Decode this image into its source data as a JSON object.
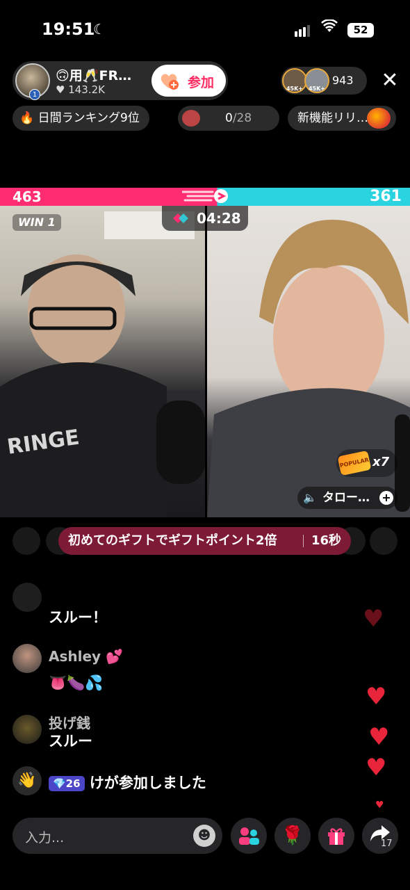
{
  "status_bar": {
    "time": "19:51",
    "battery": "52"
  },
  "host": {
    "name": "🙃用🥂FR…",
    "likes_label": "♥ 143.2K",
    "avatar_badge": "1"
  },
  "join_button": {
    "label": "参加"
  },
  "viewers": {
    "avatar_1_badge": "45K+",
    "avatar_2_badge": "45K+",
    "count": "943"
  },
  "close_label": "✕",
  "pills": {
    "ranking": "🔥 日間ランキング9位",
    "goal_current": "0",
    "goal_total": "/28",
    "new_feature": "新機能リリ…"
  },
  "battle": {
    "left_score": "463",
    "right_score": "361",
    "timer": "04:28",
    "win_label": "WIN 1",
    "popular_label": "POPULAR",
    "popular_multiplier": "x7",
    "opponent_name": "タロー…"
  },
  "gift_banner": {
    "text": "初めてのギフトでギフトポイント2倍",
    "countdown": "16秒"
  },
  "chat": {
    "faded_message": "スルー！",
    "messages": [
      {
        "name": "Ashley 💕",
        "text": "👅🍆💦"
      },
      {
        "name": "投げ銭",
        "text": "スルー"
      }
    ],
    "join_notice": {
      "level": "💎26",
      "text": "けが参加しました"
    }
  },
  "bottom": {
    "input_placeholder": "入力...",
    "share_count": "17"
  },
  "colors": {
    "accent_pink": "#ff2d6f",
    "accent_cyan": "#2ad3e0",
    "banner": "#7d1a35"
  }
}
